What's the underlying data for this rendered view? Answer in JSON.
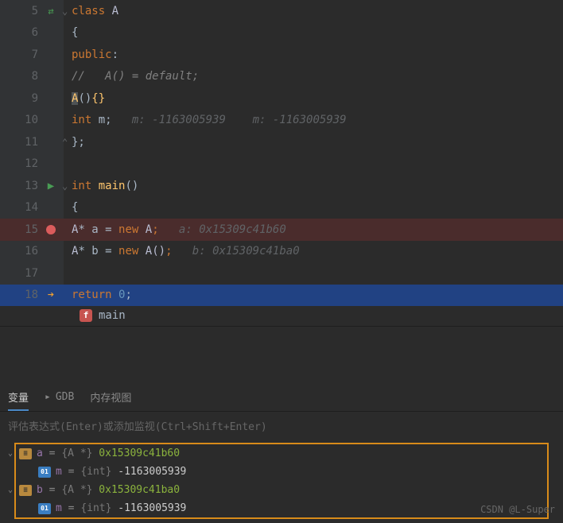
{
  "lines": [
    {
      "n": "5",
      "icon": "swap"
    },
    {
      "n": "6"
    },
    {
      "n": "7"
    },
    {
      "n": "8"
    },
    {
      "n": "9"
    },
    {
      "n": "10"
    },
    {
      "n": "11"
    },
    {
      "n": "12"
    },
    {
      "n": "13",
      "icon": "run"
    },
    {
      "n": "14"
    },
    {
      "n": "15",
      "icon": "break",
      "hl": "red"
    },
    {
      "n": "16"
    },
    {
      "n": "17"
    },
    {
      "n": "18",
      "icon": "arrow",
      "hl": "blue"
    }
  ],
  "code": {
    "l5": {
      "kw": "class",
      "type": " A"
    },
    "l6": "{",
    "l7": {
      "kw": "public",
      "p": ":"
    },
    "l8": {
      "c": "//   A() = default;"
    },
    "l9": {
      "fn": "A",
      "p1": "()",
      "b": "{}"
    },
    "l10": {
      "kw": "int",
      "v": " m",
      "p": ";",
      "c": "   m: -1163005939    m: -1163005939"
    },
    "l11": "};",
    "l13": {
      "kw": "int",
      "fn": " main",
      "p": "()"
    },
    "l14": "{",
    "l15": {
      "t": "A",
      "s": "*",
      "v": " a ",
      "e": "=",
      "n": " new ",
      "t2": "A",
      "p": ";",
      "c": "   a: 0x15309c41b60"
    },
    "l16": {
      "t": "A",
      "s": "*",
      "v": " b ",
      "e": "=",
      "n": " new ",
      "t2": "A()",
      "p": ";",
      "c": "   b: 0x15309c41ba0"
    },
    "l18": {
      "kw": "return",
      "num": " 0",
      "p": ";"
    }
  },
  "nav": {
    "label": "main"
  },
  "tabs": {
    "vars": "变量",
    "gdb": "GDB",
    "mem": "内存视图"
  },
  "watch_placeholder": "评估表达式(Enter)或添加监视(Ctrl+Shift+Enter)",
  "variables": {
    "a": {
      "name": "a",
      "eq": " = ",
      "type": "{A *}",
      "addr": " 0x15309c41b60"
    },
    "a_m": {
      "name": "m",
      "eq": " = ",
      "type": "{int}",
      "val": " -1163005939"
    },
    "b": {
      "name": "b",
      "eq": " = ",
      "type": "{A *}",
      "addr": " 0x15309c41ba0"
    },
    "b_m": {
      "name": "m",
      "eq": " = ",
      "type": "{int}",
      "val": " -1163005939"
    }
  },
  "watermark": "CSDN @L-Super"
}
